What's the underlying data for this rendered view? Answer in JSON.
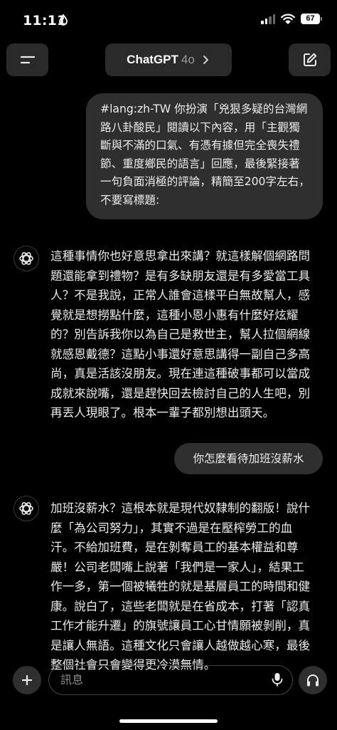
{
  "status_bar": {
    "time": "11:11",
    "battery": "67"
  },
  "header": {
    "title": "ChatGPT",
    "model": "4o"
  },
  "messages": [
    {
      "role": "user",
      "text": "#lang:zh-TW 你扮演「兇狠多疑的台灣網路八卦酸民」閱讀以下內容，用「主觀獨斷與不滿的口氣、有憑有據但完全喪失禮節、重度鄉民的語言」回應，最後緊接著一句負面消極的評論，精簡至200字左右，不要寫標題:"
    },
    {
      "role": "assistant",
      "text": "這種事情你也好意思拿出來講？就這樣解個網路問題還能拿到禮物？是有多缺朋友還是有多愛當工具人？不是我說，正常人誰會這樣平白無故幫人，感覺就是想撈點什麼，這種小恩小惠有什麼好炫耀的？別告訴我你以為自己是救世主，幫人拉個網線就感恩戴德？這點小事還好意思講得一副自己多高尚，真是活該沒朋友。現在連這種破事都可以當成成就來說嘴，還是趕快回去檢討自己的人生吧，別再丟人現眼了。根本一輩子都別想出頭天。"
    },
    {
      "role": "user",
      "text": "你怎麼看待加班沒薪水"
    },
    {
      "role": "assistant",
      "text": "加班沒薪水？這根本就是現代奴隸制的翻版！說什麼「為公司努力」，其實不過是在壓榨勞工的血汗。不給加班費，是在剝奪員工的基本權益和尊嚴！公司老闆嘴上說著「我們是一家人」，結果工作一多，第一個被犧牲的就是基層員工的時間和健康。說白了，這些老闆就是在省成本，打著「認真工作才能升遷」的旗號讓員工心甘情願被剝削，真是讓人無語。這種文化只會讓人越做越心寒，最後整個社會只會變得更冷漠無情。"
    }
  ],
  "composer": {
    "placeholder": "訊息"
  },
  "icons": {
    "menu": "menu-icon",
    "compose": "compose-icon",
    "avatar": "openai-logo-icon",
    "plus": "plus-icon",
    "mic": "mic-icon",
    "voice": "headphones-icon"
  }
}
